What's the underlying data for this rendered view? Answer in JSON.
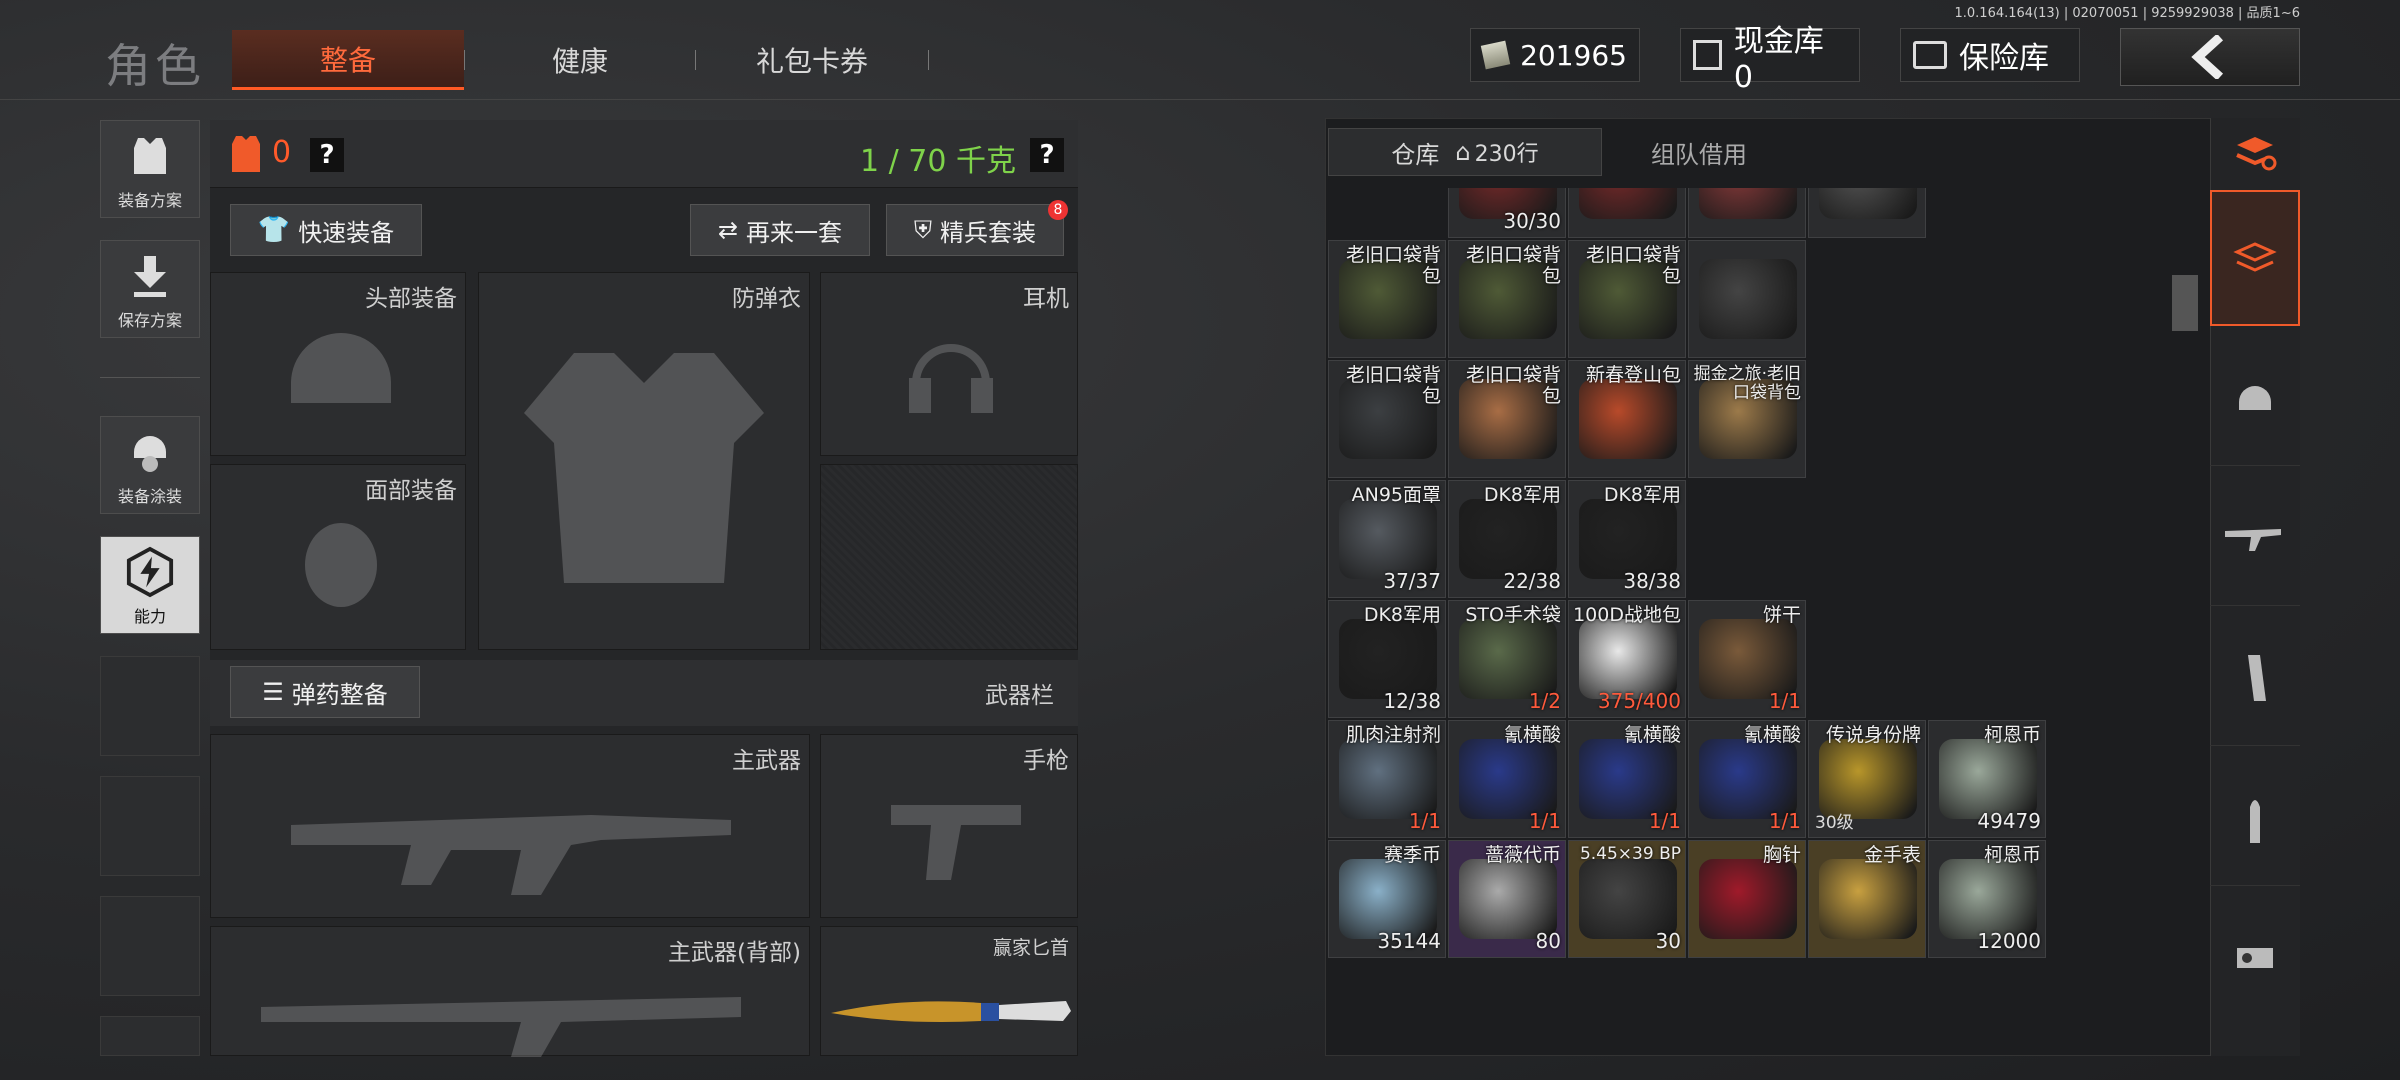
{
  "version": "1.0.164.164(13) | 02070051 | 9259929038 | 品质1~6",
  "header": {
    "title": "角色",
    "tabs": [
      {
        "label": "整备",
        "active": true
      },
      {
        "label": "健康",
        "active": false
      },
      {
        "label": "礼包卡券",
        "active": false
      }
    ],
    "money": "201965",
    "cash_vault": "现金库 0",
    "safe_box": "保险库"
  },
  "sidebar": [
    {
      "label": "装备方案",
      "icon": "vest-icon"
    },
    {
      "label": "保存方案",
      "icon": "download-icon"
    },
    {
      "label": "装备涂装",
      "icon": "helmet-skin-icon"
    },
    {
      "label": "能力",
      "icon": "lightning-icon"
    }
  ],
  "equip": {
    "count": "0",
    "weight": "1 / 70 千克",
    "quick_equip": "快速装备",
    "again": "再来一套",
    "elite": "精兵套装",
    "elite_badge": "8",
    "slots": {
      "head": "头部装备",
      "armor": "防弹衣",
      "earphone": "耳机",
      "face": "面部装备",
      "ammo_prep": "弹药整备",
      "weapon_bar": "武器栏",
      "primary": "主武器",
      "pistol": "手枪",
      "primary_back": "主武器(背部)",
      "knife": "赢家匕首"
    }
  },
  "warehouse": {
    "tab_storage": "仓库",
    "rows": "230行",
    "tab_team": "组队借用",
    "items": [
      {
        "name": "",
        "count": "30/30",
        "r": 0,
        "c": 1,
        "art": "#7a2a2a"
      },
      {
        "name": "",
        "count": "",
        "r": 0,
        "c": 2,
        "art": "#7a2a2a"
      },
      {
        "name": "",
        "count": "",
        "r": 0,
        "c": 3,
        "art": "#8a3a3a"
      },
      {
        "name": "",
        "count": "",
        "r": 0,
        "c": 4,
        "art": "#555"
      },
      {
        "name": "老旧口袋背包",
        "count": "",
        "r": 1,
        "c": 0,
        "art": "#4f5a36"
      },
      {
        "name": "老旧口袋背包",
        "count": "",
        "r": 1,
        "c": 1,
        "art": "#4f5a36"
      },
      {
        "name": "老旧口袋背包",
        "count": "",
        "r": 1,
        "c": 2,
        "art": "#4f5a36"
      },
      {
        "name": "",
        "count": "",
        "r": 1,
        "c": 3,
        "art": "#444"
      },
      {
        "name": "老旧口袋背包",
        "count": "",
        "r": 2,
        "c": 0,
        "art": "#3c3f42"
      },
      {
        "name": "老旧口袋背包",
        "count": "",
        "r": 2,
        "c": 1,
        "art": "#a86d45"
      },
      {
        "name": "新春登山包",
        "count": "",
        "r": 2,
        "c": 2,
        "art": "#b84a2a"
      },
      {
        "name": "掘金之旅·老旧口袋背包",
        "count": "",
        "r": 2,
        "c": 3,
        "art": "#9c7a4a"
      },
      {
        "name": "AN95面罩",
        "count": "37/37",
        "r": 3,
        "c": 0,
        "art": "#555a60"
      },
      {
        "name": "DK8军用",
        "count": "22/38",
        "r": 3,
        "c": 1,
        "art": "#222"
      },
      {
        "name": "DK8军用",
        "count": "38/38",
        "r": 3,
        "c": 2,
        "art": "#222"
      },
      {
        "name": "DK8军用",
        "count": "12/38",
        "r": 4,
        "c": 0,
        "art": "#222"
      },
      {
        "name": "STO手术袋",
        "count": "1/2",
        "r": 4,
        "c": 1,
        "art": "#5a6a4a",
        "red": true
      },
      {
        "name": "100D战地包",
        "count": "375/400",
        "r": 4,
        "c": 2,
        "art": "#e8e8e8",
        "red": true
      },
      {
        "name": "饼干",
        "count": "1/1",
        "r": 4,
        "c": 3,
        "art": "#7a5a3a",
        "red": true
      },
      {
        "name": "肌肉注射剂",
        "count": "1/1",
        "r": 5,
        "c": 0,
        "art": "#607080",
        "red": true
      },
      {
        "name": "氰横酸",
        "count": "1/1",
        "r": 5,
        "c": 1,
        "art": "#2a3a8a",
        "red": true
      },
      {
        "name": "氰横酸",
        "count": "1/1",
        "r": 5,
        "c": 2,
        "art": "#2a3a8a",
        "red": true
      },
      {
        "name": "氰横酸",
        "count": "1/1",
        "r": 5,
        "c": 3,
        "art": "#2a3a8a",
        "red": true
      },
      {
        "name": "传说身份牌",
        "count": "",
        "left": "30级",
        "r": 5,
        "c": 4,
        "art": "#b8962a"
      },
      {
        "name": "柯恩币",
        "count": "49479",
        "r": 5,
        "c": 5,
        "art": "#9aa89a"
      },
      {
        "name": "赛季币",
        "count": "35144",
        "r": 6,
        "c": 0,
        "art": "#8ab0c8"
      },
      {
        "name": "蔷薇代币",
        "count": "80",
        "r": 6,
        "c": 1,
        "art": "#aaa",
        "cls": "purple"
      },
      {
        "name": "5.45×39 BP",
        "count": "30",
        "r": 6,
        "c": 2,
        "art": "#444",
        "cls": "gold"
      },
      {
        "name": "胸针",
        "count": "",
        "r": 6,
        "c": 3,
        "art": "#a01a2a",
        "cls": "gold"
      },
      {
        "name": "金手表",
        "count": "",
        "r": 6,
        "c": 4,
        "art": "#c8a040",
        "cls": "gold"
      },
      {
        "name": "柯恩币",
        "count": "12000",
        "r": 6,
        "c": 5,
        "art": "#9aa89a"
      }
    ]
  }
}
